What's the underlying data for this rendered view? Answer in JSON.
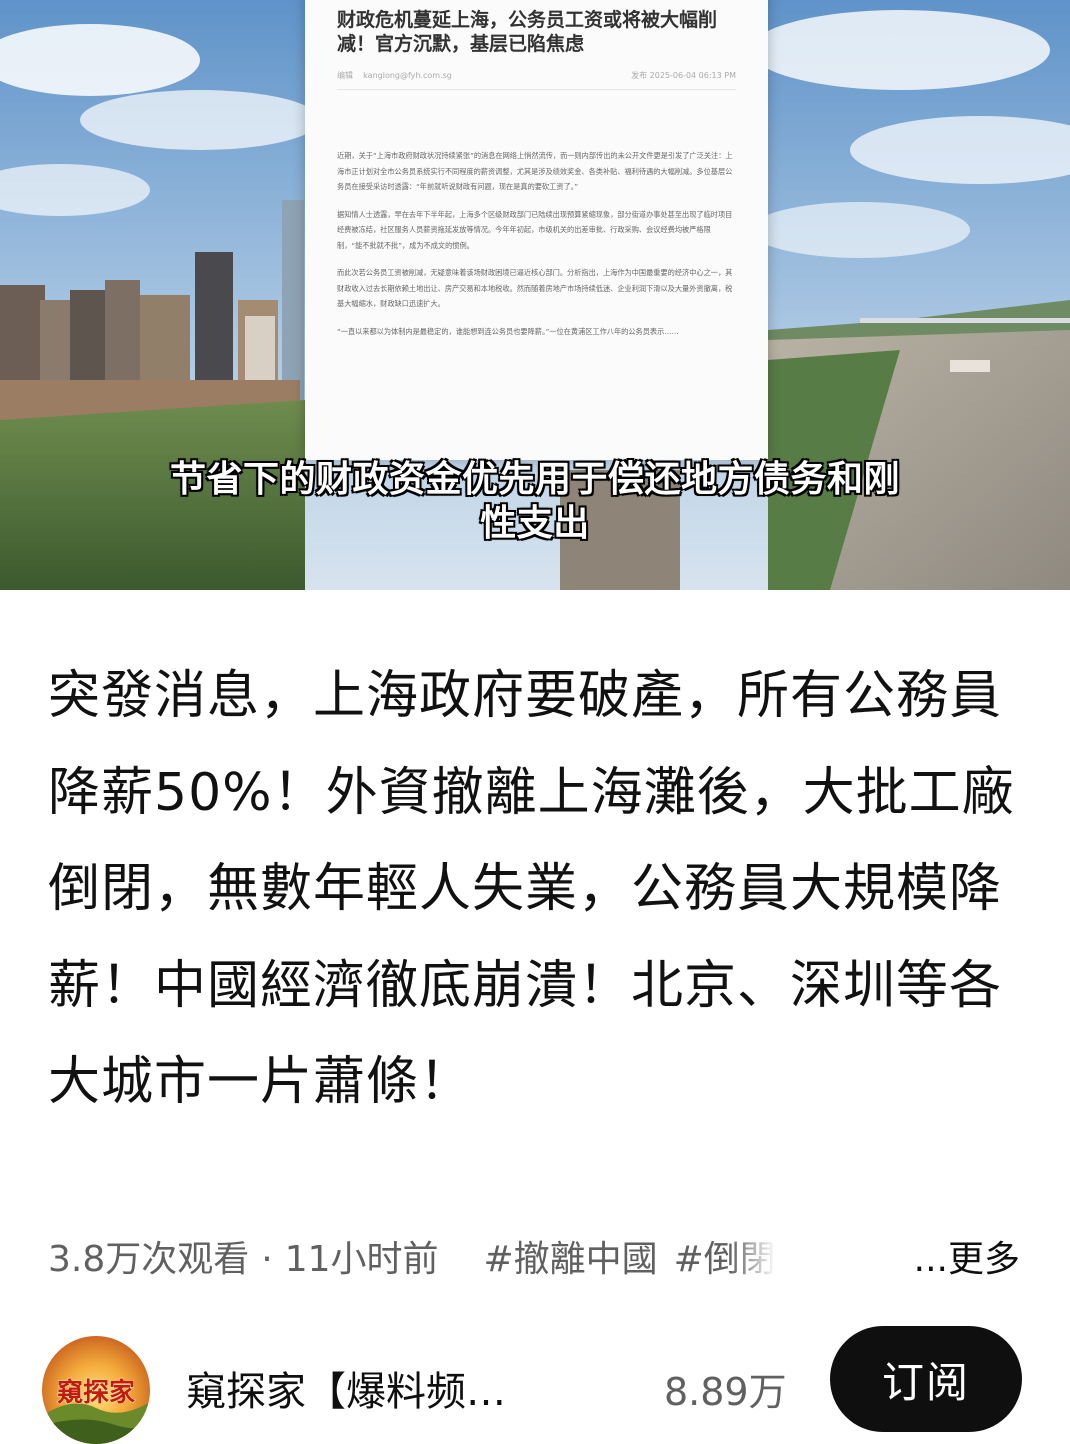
{
  "video": {
    "document": {
      "headline": "财政危机蔓延上海，公务员工资或将被大幅削\n减！官方沉默，基层已陷焦虑",
      "author": "kanglong@fyh.com.sg",
      "author_prefix": "编辑",
      "published": "发布  2025-06-04 06:13 PM",
      "paragraphs": [
        "近期，关于“上海市政府财政状况持续紧张”的消息在网络上悄然流传，而一则内部传出的未公开文件更是引发了广泛关注：上海市正计划对全市公务员系统实行不同程度的薪资调整，尤其是涉及绩效奖金、各类补贴、福利待遇的大幅削减。多位基层公务员在接受采访时透露：“年前就听说财政有问题，现在是真的要砍工资了。”",
        "据知情人士透露，早在去年下半年起，上海多个区级财政部门已陆续出现预算紧缩现象，部分街道办事处甚至出现了临时项目经费被冻结，社区服务人员薪资拖延发放等情况。今年年初起，市级机关的出差审批、行政采购、会议经费均被严格限制，“能不批就不批”，成为不成文的惯例。",
        "而此次若公务员工资被削减，无疑意味着该场财政困境已逼近核心部门。分析指出，上海作为中国最重要的经济中心之一，其财政收入过去长期依赖土地出让、房产交易和本地税收。然而随着房地产市场持续低迷、企业利润下滑以及大量外资撤离，税基大幅缩水，财政缺口迅速扩大。",
        "“一直以来都以为体制内是最稳定的，谁能想到连公务员也要降薪。”一位在黄浦区工作八年的公务员表示……"
      ]
    },
    "caption": "节省下的财政资金优先用于偿还地方债务和刚\n性支出"
  },
  "title": "突發消息，上海政府要破產，所有公務員降薪50%！外資撤離上海灘後，大批工廠倒閉，無數年輕人失業，公務員大規模降薪！中國經濟徹底崩潰！北京、深圳等各大城市一片蕭條！",
  "meta": {
    "views": "3.8万次观看",
    "separator": "·",
    "time": "11小时前",
    "tags": [
      "#撤離中國",
      "#倒閉"
    ],
    "more": "...更多"
  },
  "channel": {
    "avatar_text": "窺探家",
    "name": "窺探家【爆料频…",
    "subscribers": "8.89万",
    "subscribe_label": "订阅"
  },
  "colors": {
    "subscribe_bg": "#0f0f0f",
    "meta_text": "#606060",
    "title_text": "#111111"
  }
}
